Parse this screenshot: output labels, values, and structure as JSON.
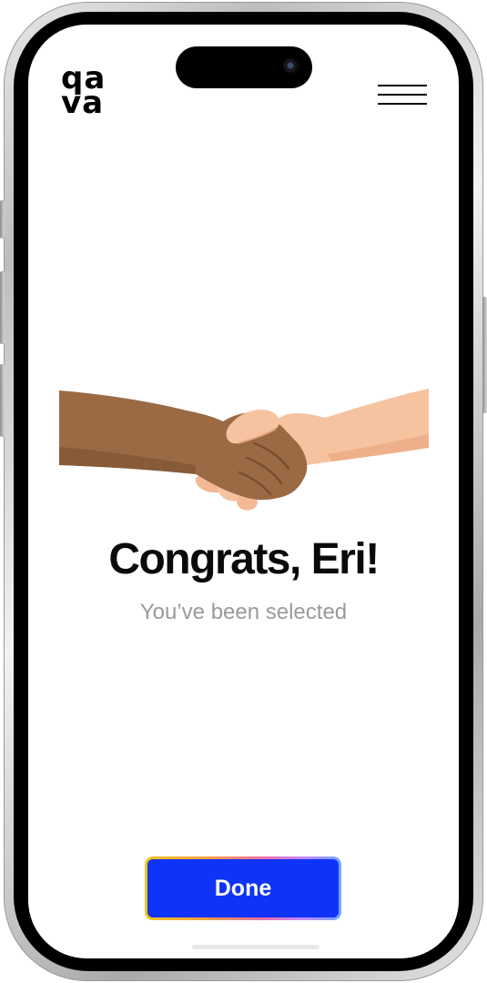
{
  "header": {
    "logo_line1": "qa",
    "logo_line2": "va"
  },
  "main": {
    "title": "Congrats, Eri!",
    "subtitle": "You’ve been selected"
  },
  "actions": {
    "done_label": "Done"
  },
  "colors": {
    "primary_button": "#0f34f8",
    "title_text": "#0a0a0a",
    "subtitle_text": "#9a9a9a"
  },
  "icons": [
    "hamburger-menu-icon",
    "camera-icon",
    "handshake-illustration"
  ]
}
